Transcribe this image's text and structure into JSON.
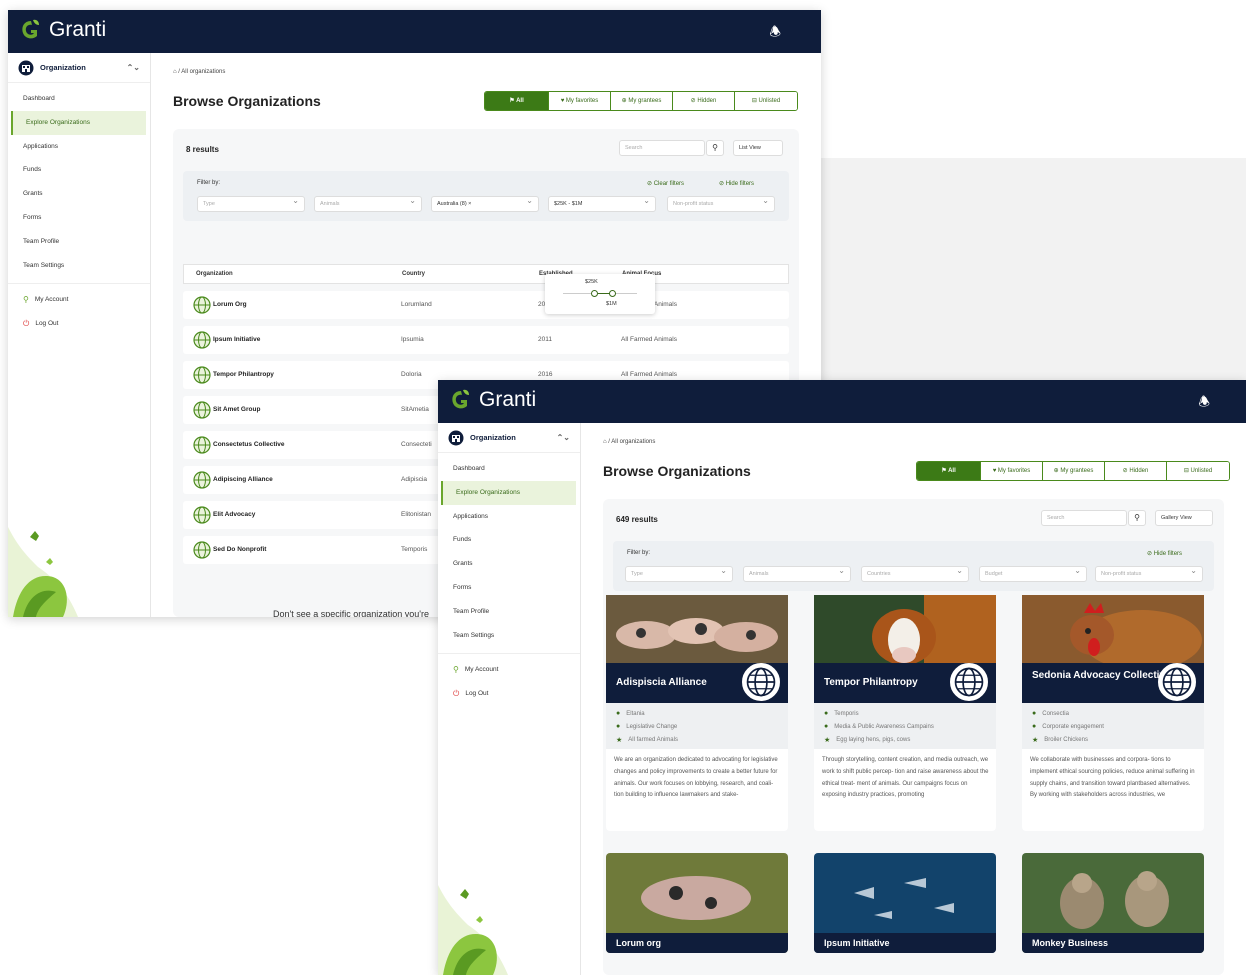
{
  "app": {
    "name": "Granti"
  },
  "sidebar": {
    "org_label": "Organization",
    "items": [
      "Dashboard",
      "Explore Organizations",
      "Applications",
      "Funds",
      "Grants",
      "Forms",
      "Team Profile",
      "Team Settings"
    ],
    "account": "My Account",
    "logout": "Log Out"
  },
  "breadcrumb": "All organizations",
  "page_title": "Browse Organizations",
  "tabs": [
    "All",
    "My favorites",
    "My grantees",
    "Hidden",
    "Unlisted"
  ],
  "list_view": {
    "results": "8 results",
    "search_placeholder": "Search",
    "view_mode": "List View",
    "filter_label": "Filter by:",
    "clear_filters": "Clear filters",
    "hide_filters": "Hide filters",
    "filters": [
      "Type",
      "Animals",
      "Australia (8) ×",
      "$25K - $1M",
      "Non-profit status"
    ],
    "budget_slider": {
      "min": "$25K",
      "max": "$1M"
    },
    "columns": [
      "Organization",
      "Country",
      "Established",
      "Animal Focus"
    ],
    "rows": [
      {
        "name": "Lorum Org",
        "country": "Lorumland",
        "year": "2023",
        "focus": "All Farmed Animals"
      },
      {
        "name": "Ipsum Initiative",
        "country": "Ipsumia",
        "year": "2011",
        "focus": "All Farmed Animals"
      },
      {
        "name": "Tempor Philantropy",
        "country": "Doloria",
        "year": "2016",
        "focus": "All Farmed Animals"
      },
      {
        "name": "Sit Amet Group",
        "country": "SitAmetia",
        "year": "",
        "focus": ""
      },
      {
        "name": "Consectetus Collective",
        "country": "Consecteti",
        "year": "",
        "focus": ""
      },
      {
        "name": "Adipiscing Alliance",
        "country": "Adipiscia",
        "year": "",
        "focus": ""
      },
      {
        "name": "Elit Advocacy",
        "country": "Elitonistan",
        "year": "",
        "focus": ""
      },
      {
        "name": "Sed Do Nonprofit",
        "country": "Temporis",
        "year": "",
        "focus": ""
      }
    ],
    "footer_text": "Don't see a specific organization you're"
  },
  "gallery_view": {
    "results": "649 results",
    "search_placeholder": "Search",
    "view_mode": "Gallery View",
    "filter_label": "Filter by:",
    "hide_filters": "Hide filters",
    "filters": [
      "Type",
      "Animals",
      "Countries",
      "Budget",
      "Non-profit status"
    ],
    "cards": [
      {
        "name": "Adispiscia Alliance",
        "location": "Eltania",
        "category": "Legislative Change",
        "animals": "All farmed Animals",
        "desc": "We are an organization dedicated to advocating for legislative changes and policy improvements to create a better future for animals. Our work focuses on lobbying, research, and coali- tion building to influence lawmakers and stake-"
      },
      {
        "name": "Tempor Philantropy",
        "location": "Temporis",
        "category": "Media & Public Awareness Campains",
        "animals": "Egg laying hens, pigs, cows",
        "desc": "Through storytelling, content creation, and media outreach, we work to shift public percep- tion and raise awareness about the ethical treat- ment of animals. Our campaigns focus on exposing industry practices, promoting"
      },
      {
        "name": "Sedonia Advocacy Collective",
        "location": "Consectia",
        "category": "Corporate engagement",
        "animals": "Broiler Chickens",
        "desc": "We collaborate with businesses and corpora- tions to implement ethical sourcing policies, reduce animal suffering in supply chains, and transition toward plantbased alternatives. By working with stakeholders across industries, we"
      }
    ],
    "second_row": [
      "Lorum org",
      "Ipsum Initiative",
      "Monkey Business"
    ]
  },
  "colors": {
    "navy": "#0f1d3b",
    "green": "#3c7a16",
    "light_green": "#eaf3dc"
  },
  "icons": {
    "bell": "bell-icon",
    "home": "home-icon",
    "globe": "globe-icon",
    "search": "search-icon"
  }
}
